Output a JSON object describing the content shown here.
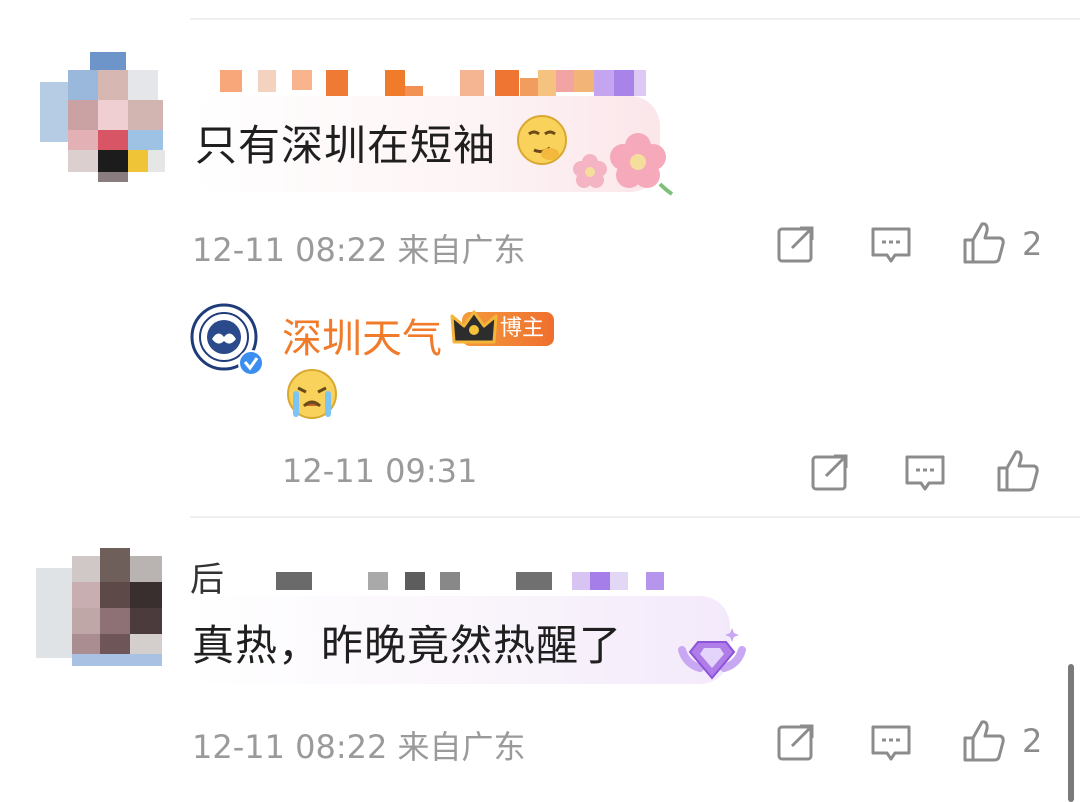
{
  "comments": [
    {
      "text": "只有深圳在短袖",
      "meta": "12-11 08:22 来自广东",
      "likes": "2",
      "emoji": "smirk-face-emoji",
      "decoration": "cherry-blossom-icon"
    },
    {
      "text": "真热，昨晚竟然热醒了",
      "meta": "12-11 08:22 来自广东",
      "likes": "2",
      "name_fragment": "后",
      "decoration": "purple-gem-badge-icon"
    }
  ],
  "reply": {
    "author": "深圳天气",
    "badge": "博主",
    "meta": "12-11 09:31",
    "emoji": "crying-face-emoji",
    "verified": true
  },
  "colors": {
    "accent_orange": "#f07b2a",
    "meta_gray": "#9a9a9a",
    "icon_gray": "#8c8c8c"
  }
}
